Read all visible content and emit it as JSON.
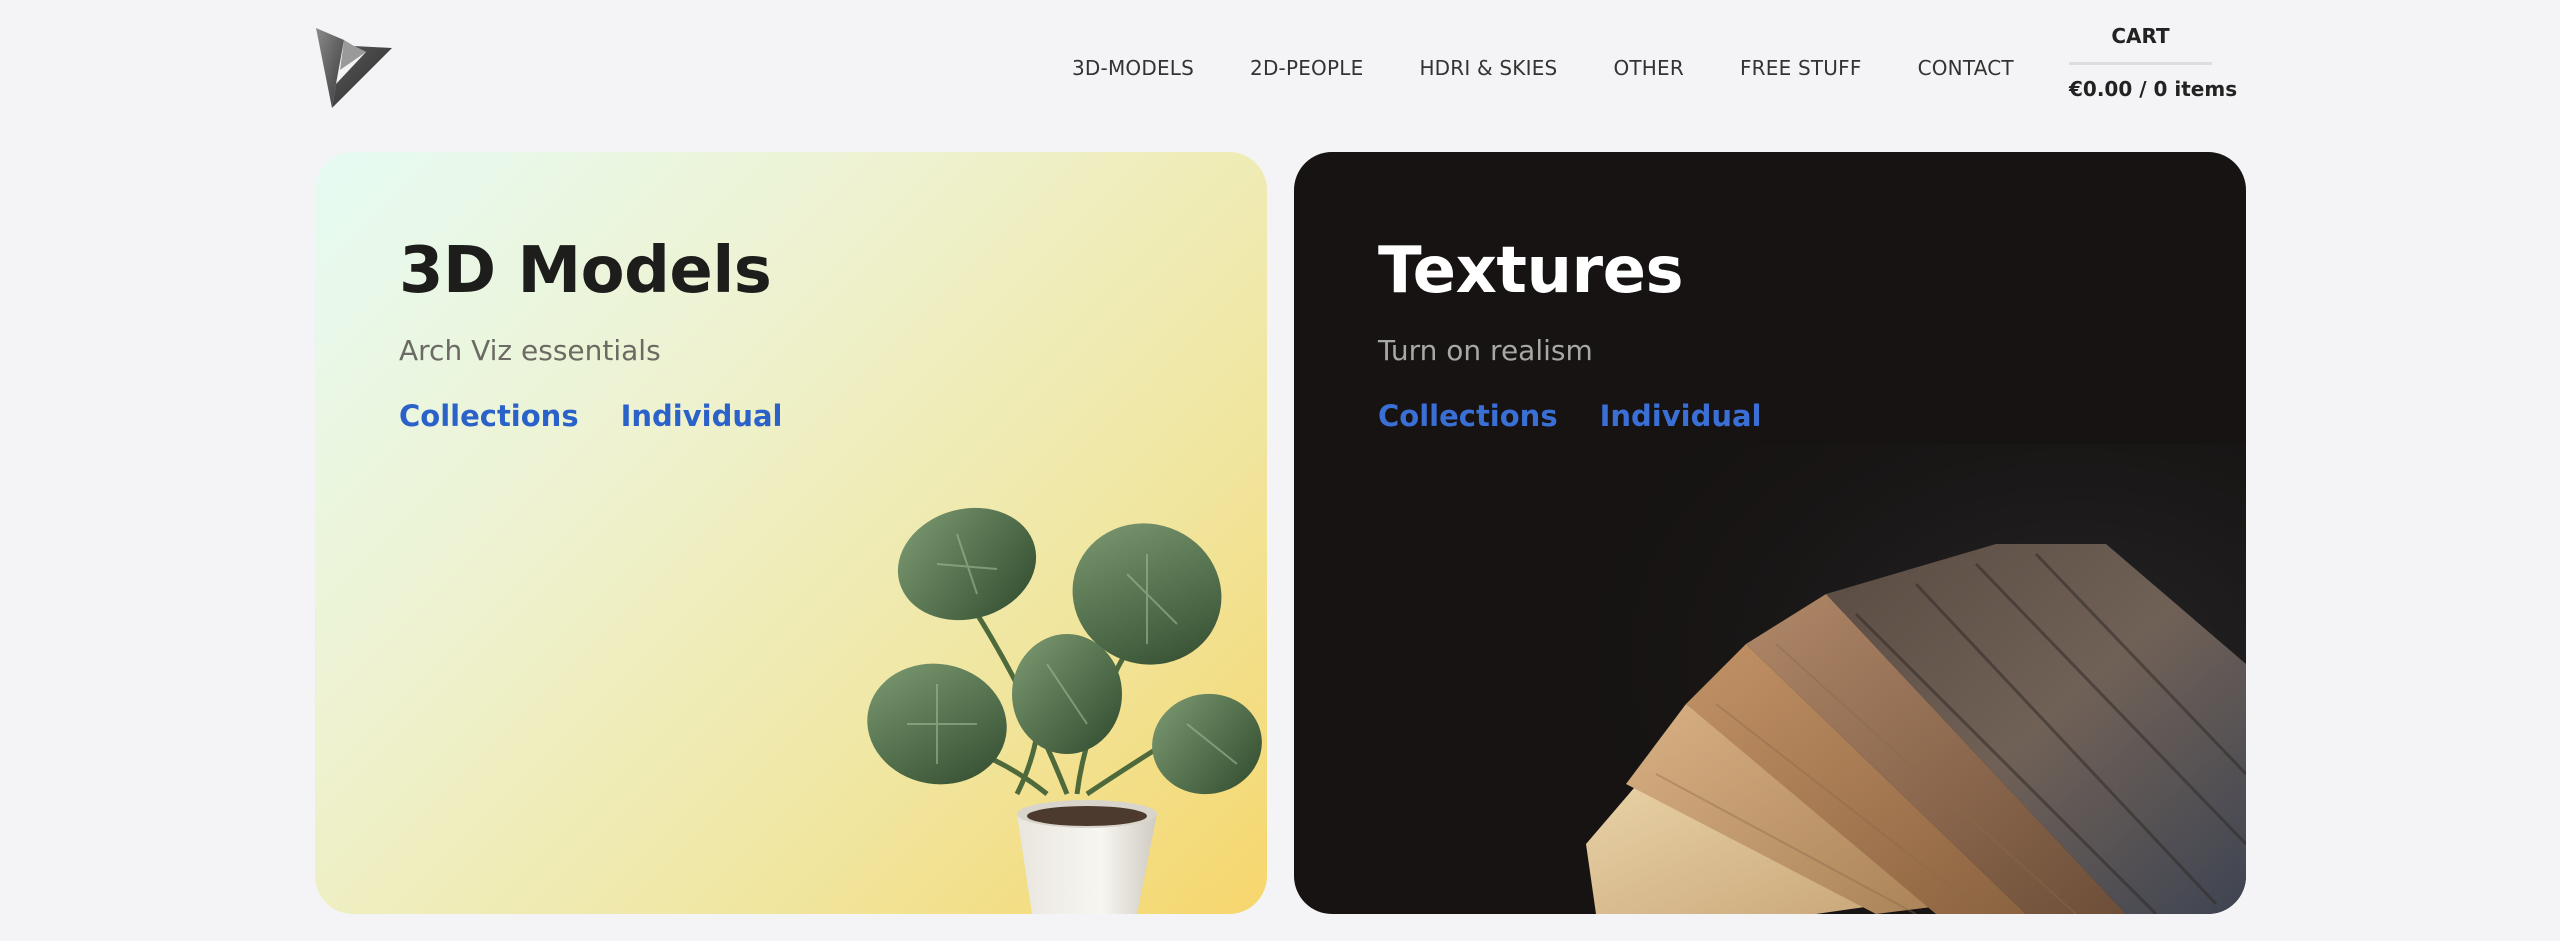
{
  "nav": {
    "items": [
      {
        "label": "3D-MODELS"
      },
      {
        "label": "2D-PEOPLE"
      },
      {
        "label": "HDRI & SKIES"
      },
      {
        "label": "OTHER"
      },
      {
        "label": "FREE STUFF"
      },
      {
        "label": "CONTACT"
      }
    ]
  },
  "cart": {
    "title": "CART",
    "total": "€0.00 / 0 items"
  },
  "cards": [
    {
      "title": "3D Models",
      "subtitle": "Arch Viz essentials",
      "links": [
        {
          "label": "Collections"
        },
        {
          "label": "Individual"
        }
      ],
      "image_icon": "monstera-plant-image"
    },
    {
      "title": "Textures",
      "subtitle": "Turn on realism",
      "links": [
        {
          "label": "Collections"
        },
        {
          "label": "Individual"
        }
      ],
      "image_icon": "wood-veneer-samples-image"
    }
  ],
  "colors": {
    "link": "#2a62c9",
    "background": "#f4f4f6",
    "textures_card": "#161312"
  }
}
